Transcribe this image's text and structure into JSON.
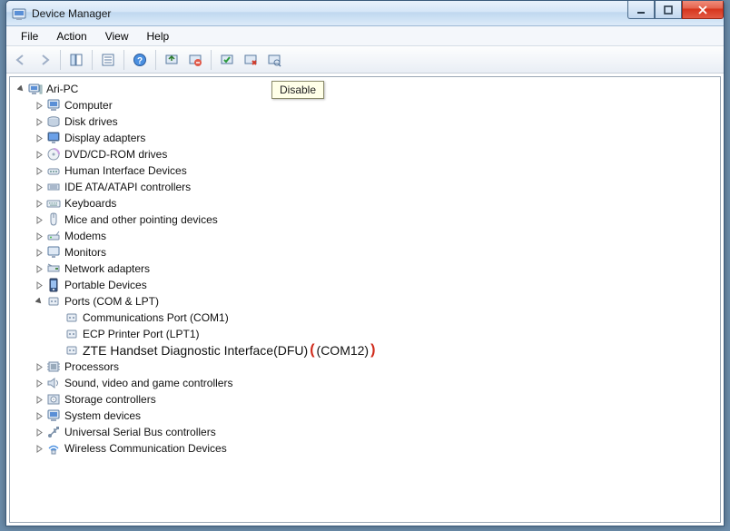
{
  "window": {
    "title": "Device Manager"
  },
  "menu": {
    "file": "File",
    "action": "Action",
    "view": "View",
    "help": "Help"
  },
  "tooltip": "Disable",
  "tree": {
    "root": "Ari-PC",
    "computer": "Computer",
    "disk": "Disk drives",
    "display": "Display adapters",
    "dvd": "DVD/CD-ROM drives",
    "hid": "Human Interface Devices",
    "ide": "IDE ATA/ATAPI controllers",
    "kbd": "Keyboards",
    "mice": "Mice and other pointing devices",
    "modems": "Modems",
    "monitors": "Monitors",
    "net": "Network adapters",
    "portable": "Portable Devices",
    "ports": "Ports (COM & LPT)",
    "port_com1": "Communications Port (COM1)",
    "port_lpt1": "ECP Printer Port (LPT1)",
    "port_zte_a": "ZTE Handset Diagnostic Interface(DFU)",
    "port_zte_b": "(COM12)",
    "processors": "Processors",
    "sound": "Sound, video and game controllers",
    "storage": "Storage controllers",
    "system": "System devices",
    "usb": "Universal Serial Bus controllers",
    "wireless": "Wireless Communication Devices"
  },
  "annot": {
    "l": "(",
    "r": ")"
  }
}
